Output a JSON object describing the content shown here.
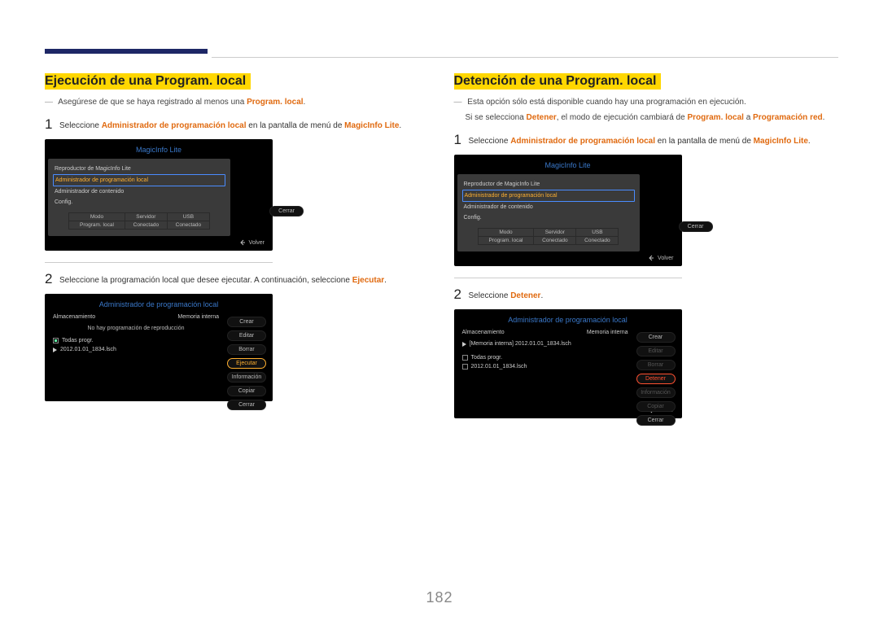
{
  "page": {
    "number": "182"
  },
  "left": {
    "title": "Ejecución de una Program. local",
    "note_pre": "Asegúrese de que se haya registrado al menos una ",
    "note_hl": "Program. local",
    "step1_pre": "Seleccione ",
    "step1_b1": "Administrador de programación local",
    "step1_mid": " en la pantalla de menú de ",
    "step1_b2": "MagicInfo Lite",
    "step2_pre": "Seleccione la programación local que desee ejecutar. A continuación, seleccione ",
    "step2_b": "Ejecutar",
    "panel": {
      "title": "MagicInfo Lite",
      "row1": "Reproductor de MagicInfo Lite",
      "row2": "Administrador de programación local",
      "row3": "Administrador de contenido",
      "row4": "Config.",
      "btn_cerrar": "Cerrar",
      "st_h1": "Modo",
      "st_h2": "Servidor",
      "st_h3": "USB",
      "st_v1": "Program. local",
      "st_v2": "Conectado",
      "st_v3": "Conectado",
      "volver": "Volver"
    },
    "apanel": {
      "title": "Administrador de programación local",
      "storage_l": "Almacenamiento",
      "storage_r": "Memoria interna",
      "msg": "No hay programación de reproducción",
      "todas": "Todas progr.",
      "file": "2012.01.01_1834.lsch",
      "btns": {
        "crear": "Crear",
        "editar": "Editar",
        "borrar": "Borrar",
        "ejecutar": "Ejecutar",
        "info": "Información",
        "copiar": "Copiar",
        "cerrar": "Cerrar"
      }
    }
  },
  "right": {
    "title": "Detención de una Program. local",
    "l1": "Esta opción sólo está disponible cuando hay una programación en ejecución.",
    "l2_pre": "Si se selecciona ",
    "l2_b1": "Detener",
    "l2_mid": ", el modo de ejecución cambiará de ",
    "l2_b2": "Program. local",
    "l2_a": " a ",
    "l2_b3": "Programación red",
    "step1_pre": "Seleccione ",
    "step1_b1": "Administrador de programación local",
    "step1_mid": " en la pantalla de menú de ",
    "step1_b2": "MagicInfo Lite",
    "step2_pre": "Seleccione ",
    "step2_b": "Detener",
    "apanel": {
      "title": "Administrador de programación local",
      "storage_l": "Almacenamiento",
      "storage_r": "Memoria interna",
      "msg": "[Memoria interna] 2012.01.01_1834.lsch",
      "todas": "Todas progr.",
      "file": "2012.01.01_1834.lsch",
      "btns": {
        "crear": "Crear",
        "editar": "Editar",
        "borrar": "Borrar",
        "detener": "Detener",
        "info": "Información",
        "copiar": "Copiar",
        "cerrar": "Cerrar"
      }
    }
  }
}
